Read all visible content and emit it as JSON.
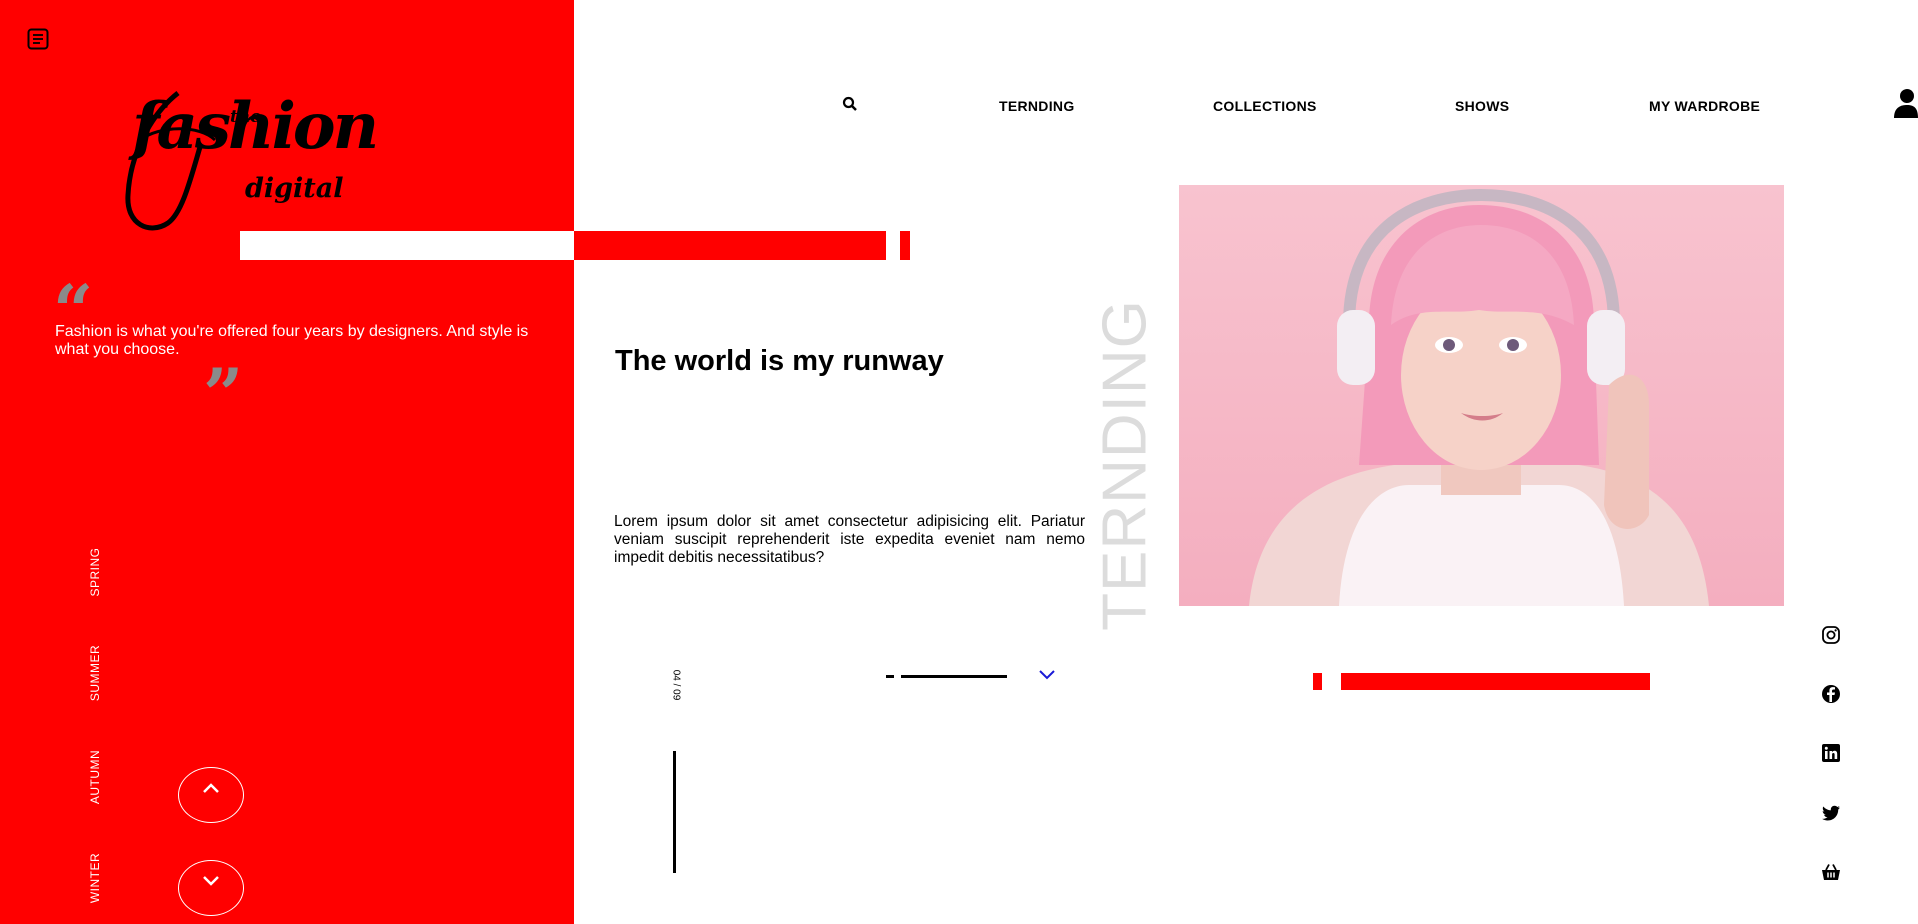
{
  "colors": {
    "accent": "#ff0000",
    "quote_mark": "#8a8a8a",
    "vertical_word": "#dcdcdc",
    "hero_bg": "#f7c2cf"
  },
  "sidebar": {
    "menu_icon": "menu-icon",
    "logo": {
      "the": "the",
      "fashion": "fashion",
      "digital": "digital"
    },
    "quote": {
      "open_mark": "“",
      "text": "Fashion is what you're offered four years by designers. And style is what you choose.",
      "close_mark": "”"
    },
    "seasons": [
      "SPRING",
      "SUMMER",
      "AUTUMN",
      "WINTER"
    ],
    "up_icon": "chevron-up-icon",
    "down_icon": "chevron-down-icon"
  },
  "nav": {
    "search_icon": "search-icon",
    "links": [
      "TERNDING",
      "COLLECTIONS",
      "SHOWS",
      "MY WARDROBE"
    ],
    "user_icon": "user-icon"
  },
  "main": {
    "headline": "The world is my runway",
    "body": "Lorem ipsum dolor sit amet consectetur adipisicing elit. Pariatur veniam suscipit reprehenderit iste expedita eveniet nam nemo impedit debitis necessitatibus?",
    "vertical_word": "TERNDING",
    "page_counter": "04 / 09",
    "slider_chevron": "chevron-down-icon"
  },
  "social": [
    "instagram-icon",
    "facebook-icon",
    "linkedin-icon",
    "twitter-icon",
    "basket-icon"
  ]
}
